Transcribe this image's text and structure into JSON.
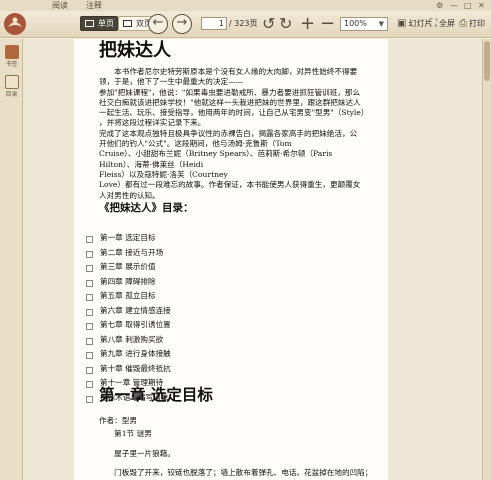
{
  "menu": {
    "read": "阅读",
    "notes": "注释"
  },
  "window_controls": {
    "settings": "⚙",
    "minimize": "—",
    "maximize": "□",
    "close": "✕"
  },
  "toolbar": {
    "single_page": "单页",
    "double_page": "双页",
    "prev": "←",
    "next": "→",
    "current_page": "1",
    "total_pages": "/ 323页",
    "zoom_value": "100%",
    "slideshow": "幻灯片",
    "fullscreen": "全屏",
    "print": "打印"
  },
  "sidebar": {
    "bookmarks": "书签",
    "toc": "目录"
  },
  "colors": {
    "accent": "#5c4f3b",
    "toolbar_bg": "#e3d6bb",
    "active_segment": "#4a4339"
  },
  "document": {
    "title": "把妹达人",
    "intro_lines": [
      "　　本书作者尼尔史特劳斯原本是个没有女人缘的大肉脚，对异性始终不得要",
      "领，于是，他下了一生中最重大的决定——",
      "参加\"把妹课程\"，他说：\"如果毒虫要进勒戒所、暴力者要进抓狂管训班，那么",
      "社交白痴就该进把妹学校！\"他就这样一头栽进把妹的世界里，跟这群把妹达人",
      "一起生活、玩乐、接受指导，他用两年的时间，让自己从宅男变\"型男\"（Style）",
      "，并将这段过程详实记录下来。",
      "完成了这本观点独特且极具争议性的赤裸告白，揭露各家高手的把妹绝活，公",
      "开他们的钓人\"公式\"。这段期间，他与汤姆·克鲁斯（Tom",
      "Cruise）、小甜甜布兰妮（Britney Spears）、芭莉斯·希尔顿（Paris",
      "Hilton）、海蒂·佛莱丝（Heidi",
      "Fleiss）以及寇特妮·洛芙（Courtney",
      "Love）都有过一段难忘的故事。作者保证，本书能使男人获得重生，更颠覆女",
      "人对男性的认知。"
    ],
    "toc_heading": "《把妹达人》目录：",
    "toc": [
      "第一章 选定目标",
      "第二章 接近与开场",
      "第三章 展示价值",
      "第四章 障碍排除",
      "第五章 孤立目标",
      "第六章 建立情感连接",
      "第七章 取得引诱位置",
      "第八章 刺激购买欲",
      "第九章 进行身体接触",
      "第十章 催毁最终抵抗",
      "第十一章 管理期待",
      "把妹术语与缩写清单"
    ],
    "chapter_heading": "第一章 选定目标",
    "author_line": "作者：型男",
    "section_line": "　　第1节 谜男",
    "body_lines": [
      "　　屋子里一片狼藉。",
      "　　门板毁了开来，铰链也脱落了；墙上散布着弹孔、电话、花盆掉在地的凹陷；"
    ]
  }
}
